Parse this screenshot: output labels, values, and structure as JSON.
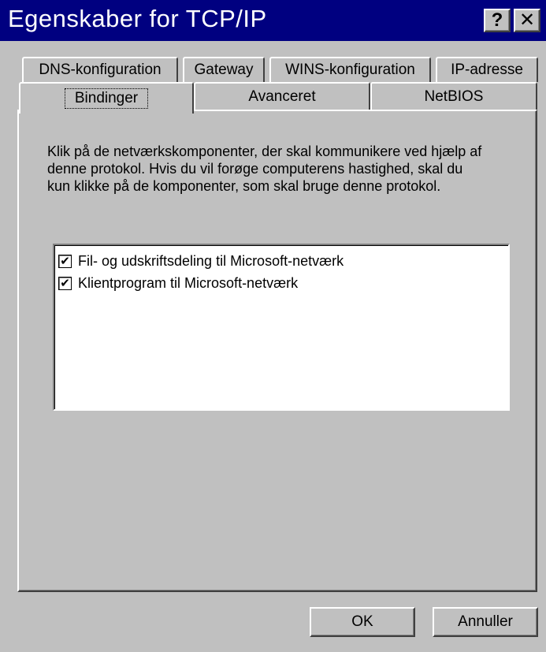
{
  "window": {
    "title": "Egenskaber for TCP/IP",
    "help_label": "?",
    "close_label": "✕",
    "title_bar_color": "#000080",
    "face_color": "#c0c0c0"
  },
  "tabs": {
    "row1": [
      "DNS-konfiguration",
      "Gateway",
      "WINS-konfiguration",
      "IP-adresse"
    ],
    "row2": [
      "Bindinger",
      "Avanceret",
      "NetBIOS"
    ],
    "active": "Bindinger"
  },
  "bindings": {
    "description": "Klik på de netværkskomponenter, der skal kommunikere ved hjælp af denne protokol. Hvis du vil forøge computerens hastighed, skal du kun klikke på de komponenter, som skal bruge denne protokol.",
    "items": [
      {
        "label": "Fil- og udskriftsdeling til Microsoft-netværk",
        "checked": true
      },
      {
        "label": "Klientprogram til Microsoft-netværk",
        "checked": true
      }
    ]
  },
  "buttons": {
    "ok": "OK",
    "cancel": "Annuller"
  }
}
